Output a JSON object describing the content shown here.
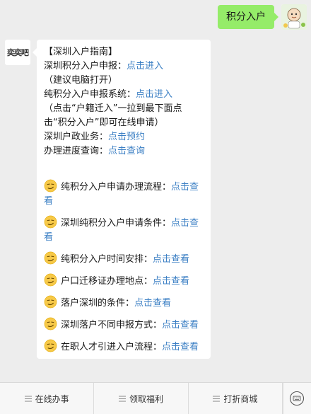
{
  "outgoing": {
    "text": "积分入户"
  },
  "incoming": {
    "avatar_text": "奕奕吧",
    "header": "【深圳入户指南】",
    "lines": [
      {
        "label": "深圳积分入户申报：",
        "link": "点击进入"
      },
      {
        "label": "（建议电脑打开）",
        "link": ""
      },
      {
        "label": "纯积分入户申报系统：",
        "link": "点击进入"
      },
      {
        "label": "（点击“户籍迁入”一拉到最下面点击“积分入户”即可在线申请）",
        "link": ""
      },
      {
        "label": "深圳户政业务：",
        "link": "点击预约"
      },
      {
        "label": "办理进度查询：",
        "link": "点击查询"
      }
    ],
    "emoji_items": [
      {
        "label": "纯积分入户申请办理流程：",
        "link": "点击查看"
      },
      {
        "label": "深圳纯积分入户申请条件：",
        "link": "点击查看"
      },
      {
        "label": "纯积分入户时间安排：",
        "link": "点击查看"
      },
      {
        "label": "户口迁移证办理地点：",
        "link": "点击查看"
      },
      {
        "label": "落户深圳的条件：",
        "link": "点击查看"
      },
      {
        "label": "深圳落户不同申报方式：",
        "link": "点击查看"
      },
      {
        "label": "在职人才引进入户流程：",
        "link": "点击查看"
      }
    ]
  },
  "menu": {
    "items": [
      {
        "label": "在线办事",
        "icon": "menu-lines-icon"
      },
      {
        "label": "领取福利",
        "icon": "menu-lines-icon"
      },
      {
        "label": "打折商城",
        "icon": "menu-lines-icon"
      }
    ],
    "keyboard_icon": "keyboard-toggle-icon"
  },
  "colors": {
    "outgoing_bubble": "#95ec69",
    "link": "#3b7fc4",
    "background": "#ededed"
  }
}
